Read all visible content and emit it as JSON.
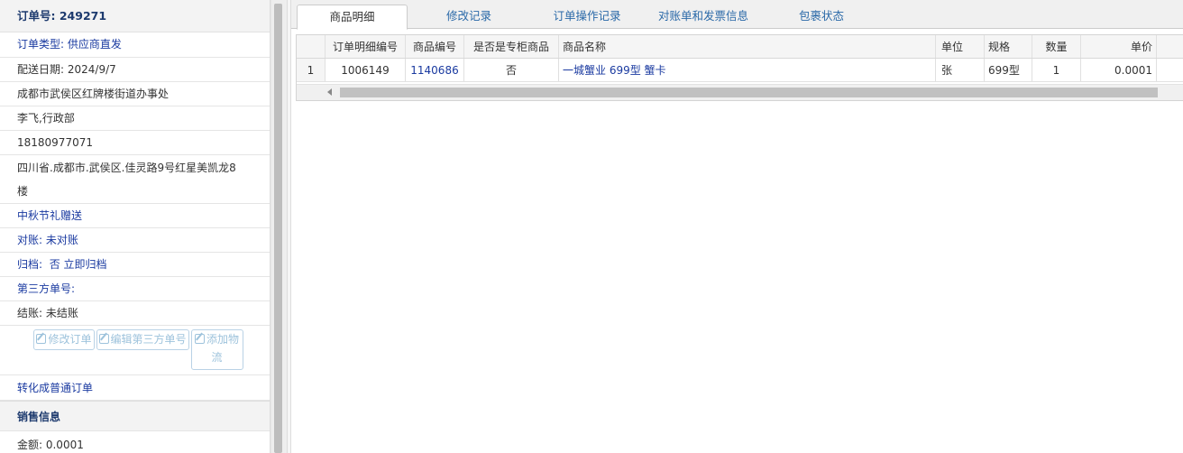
{
  "order": {
    "header_label": "订单号:",
    "number": "249271",
    "type": "订单类型: 供应商直发",
    "delivery_date": "配送日期: 2024/9/7",
    "office": "成都市武侯区红牌楼街道办事处",
    "contact": "李飞,行政部",
    "phone": "18180977071",
    "address_line1": "四川省.成都市.武侯区.佳灵路9号红星美凯龙8",
    "address_line2": "楼",
    "note": "中秋节礼赠送",
    "reconcile": "对账: 未对账",
    "archive_label": "归档:",
    "archive_value": "否",
    "archive_link": "立即归档",
    "third_party": "第三方单号:",
    "settle": "结账: 未结账",
    "buttons": {
      "edit_order": "修改订单",
      "edit_third": "编辑第三方单号",
      "add_logistics_1": "添加物",
      "add_logistics_2": "流"
    },
    "convert": "转化成普通订单",
    "sales_section": "销售信息",
    "amount": "金额: 0.0001"
  },
  "tabs": [
    {
      "label": "商品明细",
      "active": true
    },
    {
      "label": "修改记录"
    },
    {
      "label": "订单操作记录"
    },
    {
      "label": "对账单和发票信息"
    },
    {
      "label": "包裹状态"
    }
  ],
  "grid": {
    "headers": [
      "订单明细编号",
      "商品编号",
      "是否是专柜商品",
      "商品名称",
      "单位",
      "规格",
      "数量",
      "单价"
    ],
    "rows": [
      {
        "index": "1",
        "detail_id": "1006149",
        "product_id": "1140686",
        "counter": "否",
        "name": "一城蟹业 699型 蟹卡",
        "unit": "张",
        "spec": "699型",
        "qty": "1",
        "price": "0.0001"
      }
    ]
  }
}
